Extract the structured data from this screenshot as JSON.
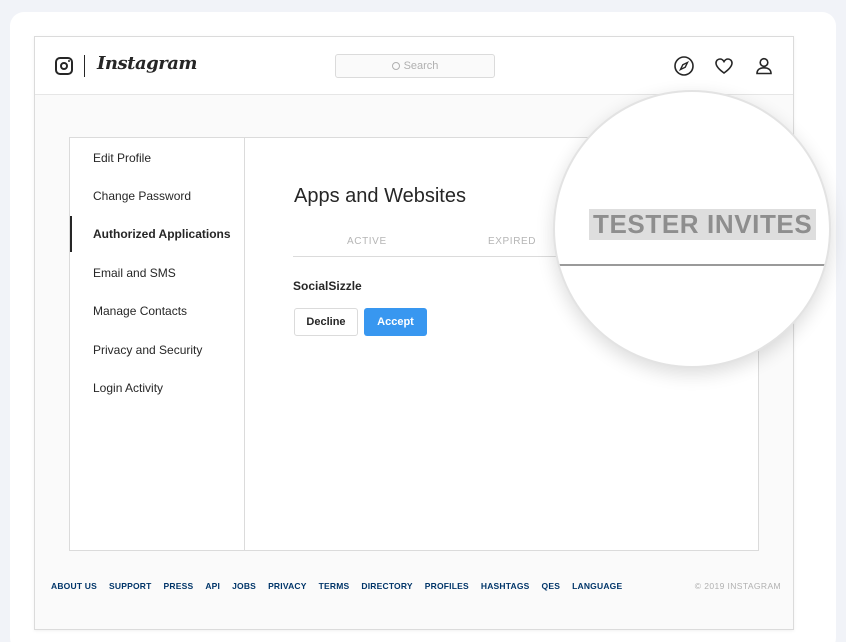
{
  "app": {
    "name": "Instagram"
  },
  "search": {
    "placeholder": "Search"
  },
  "nav": {
    "icons": [
      "compass-icon",
      "heart-icon",
      "profile-icon"
    ]
  },
  "sidebar": {
    "items": [
      {
        "label": "Edit Profile",
        "active": false
      },
      {
        "label": "Change Password",
        "active": false
      },
      {
        "label": "Authorized Applications",
        "active": true
      },
      {
        "label": "Email and SMS",
        "active": false
      },
      {
        "label": "Manage Contacts",
        "active": false
      },
      {
        "label": "Privacy and Security",
        "active": false
      },
      {
        "label": "Login Activity",
        "active": false
      }
    ]
  },
  "main": {
    "title": "Apps and Websites",
    "tabs": [
      {
        "label": "ACTIVE"
      },
      {
        "label": "EXPIRED"
      },
      {
        "label": "TESTER INVITES"
      }
    ],
    "invite": {
      "app_name": "SocialSizzle",
      "decline_label": "Decline",
      "accept_label": "Accept"
    }
  },
  "footer": {
    "links": [
      "ABOUT US",
      "SUPPORT",
      "PRESS",
      "API",
      "JOBS",
      "PRIVACY",
      "TERMS",
      "DIRECTORY",
      "PROFILES",
      "HASHTAGS",
      "QES",
      "LANGUAGE"
    ],
    "copyright": "© 2019 INSTAGRAM"
  },
  "colors": {
    "accent": "#3897f0",
    "text": "#262626",
    "muted": "#b5b5b5",
    "footer_link": "#003569"
  }
}
